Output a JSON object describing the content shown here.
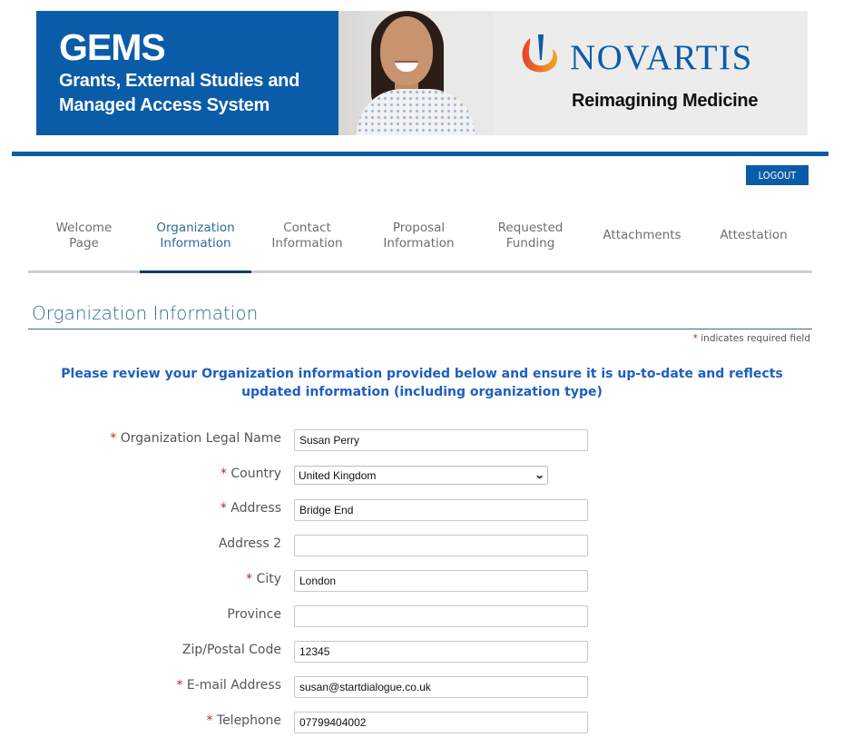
{
  "banner": {
    "app_name": "GEMS",
    "app_subtitle_line1": "Grants, External Studies and",
    "app_subtitle_line2": "Managed Access System",
    "brand_name": "NOVARTIS",
    "brand_tagline": "Reimagining Medicine"
  },
  "header": {
    "logout_label": "LOGOUT"
  },
  "tabs": [
    {
      "label_line1": "Welcome",
      "label_line2": "Page",
      "active": false
    },
    {
      "label_line1": "Organization",
      "label_line2": "Information",
      "active": true
    },
    {
      "label_line1": "Contact",
      "label_line2": "Information",
      "active": false
    },
    {
      "label_line1": "Proposal",
      "label_line2": "Information",
      "active": false
    },
    {
      "label_line1": "Requested",
      "label_line2": "Funding",
      "active": false
    },
    {
      "label_line1": "Attachments",
      "label_line2": "",
      "active": false
    },
    {
      "label_line1": "Attestation",
      "label_line2": "",
      "active": false
    }
  ],
  "page": {
    "title": "Organization Information",
    "required_star": "*",
    "required_note": "indicates required field",
    "notice": "Please review your Organization information provided below and ensure it is up-to-date and reflects updated information (including organization type)"
  },
  "form": {
    "fields": [
      {
        "label": "Organization Legal Name",
        "required": true,
        "type": "text",
        "value": "Susan Perry"
      },
      {
        "label": "Country",
        "required": true,
        "type": "select",
        "value": "United Kingdom"
      },
      {
        "label": "Address",
        "required": true,
        "type": "text",
        "value": "Bridge End"
      },
      {
        "label": "Address 2",
        "required": false,
        "type": "text",
        "value": ""
      },
      {
        "label": "City",
        "required": true,
        "type": "text",
        "value": "London"
      },
      {
        "label": "Province",
        "required": false,
        "type": "text",
        "value": ""
      },
      {
        "label": "Zip/Postal Code",
        "required": false,
        "type": "text",
        "value": "12345"
      },
      {
        "label": "E-mail Address",
        "required": true,
        "type": "text",
        "value": "susan@startdialogue.co.uk"
      },
      {
        "label": "Telephone",
        "required": true,
        "type": "text",
        "value": "07799404002"
      }
    ]
  },
  "colors": {
    "brand_blue": "#0b5ca8",
    "title_blue": "#2e6a99",
    "notice_blue": "#1f5fbf",
    "required_red": "#c0262c"
  }
}
